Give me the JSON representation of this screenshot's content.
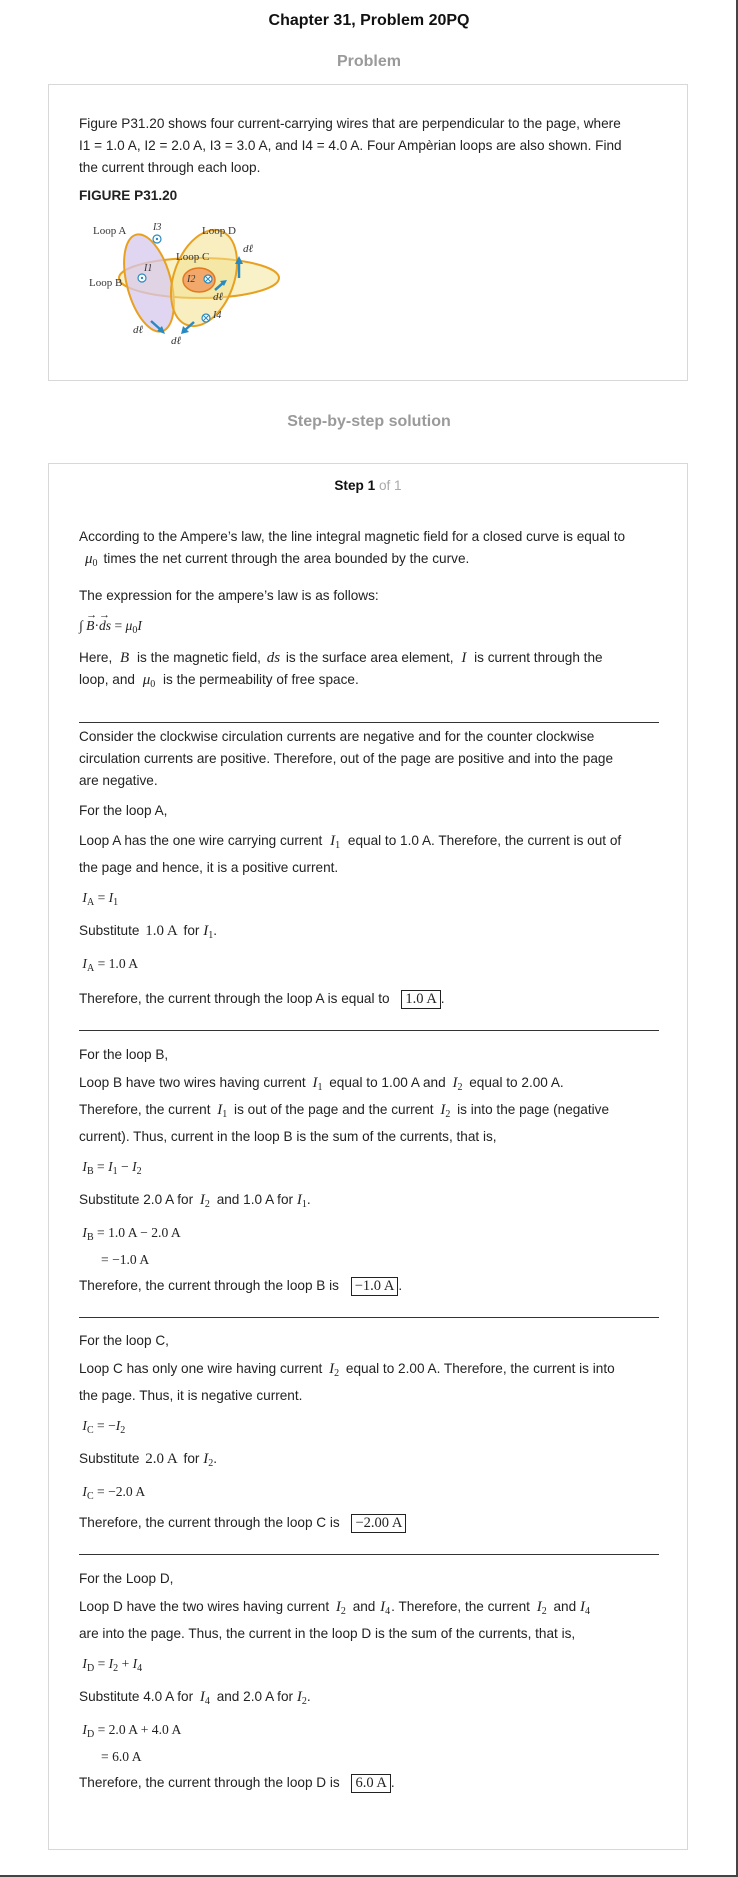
{
  "header": {
    "chapter_title": "Chapter 31, Problem 20PQ",
    "problem_label": "Problem",
    "solution_label": "Step-by-step solution"
  },
  "problem": {
    "text_line1": "Figure P31.20 shows four current-carrying wires that are perpendicular to the page, where",
    "text_line2": "I1 = 1.0 A, I2 = 2.0 A, I3 = 3.0 A, and I4 = 4.0 A. Four Ampèrian loops are also shown. Find",
    "text_line3": "the current through each loop.",
    "figure_label": "FIGURE P31.20",
    "figure": {
      "loop_a": "Loop A",
      "loop_b": "Loop B",
      "loop_c": "Loop C",
      "loop_d": "Loop D",
      "i1": "I1",
      "i2": "I2",
      "i3": "I3",
      "i4": "I4",
      "dl": "dℓ"
    }
  },
  "step": {
    "label": "Step 1",
    "of": "of 1"
  },
  "intro": {
    "p1_l1": "According to the Ampere’s law, the line integral magnetic field for a closed curve is equal to",
    "p1_l2": "times the net current through the area bounded by the curve.",
    "p2": "The expression for the ampere’s law is as follows:",
    "eq": "∫ B · ds = μ0 I",
    "p3_l1a": "Here,",
    "p3_l1b": "is the magnetic field,",
    "p3_l1c": "is the surface area element,",
    "p3_l1d": "is current through the",
    "p3_l2a": "loop, and",
    "p3_l2b": "is the permeability of free space."
  },
  "sign": {
    "l1": "Consider the clockwise circulation currents are negative and for the counter clockwise",
    "l2": "circulation currents are positive. Therefore, out of the page are positive and into the page",
    "l3": "are negative."
  },
  "loop_a": {
    "heading": "For the loop A,",
    "l1a": "Loop A has the one wire carrying current",
    "l1b": "equal to 1.0 A. Therefore, the current is out of",
    "l2": "the page and hence, it is a positive current.",
    "eq1": "IA = I1",
    "sub_a": "Substitute",
    "sub_val": "1.0 A",
    "sub_for": "for",
    "eq2": "IA = 1.0 A",
    "concl": "Therefore, the current through the loop A is equal to",
    "answer": "1.0 A"
  },
  "loop_b": {
    "heading": "For the loop B,",
    "l1a": "Loop B have two wires having current",
    "l1b": "equal to 1.00 A and",
    "l1c": "equal to 2.00 A.",
    "l2a": "Therefore, the current",
    "l2b": "is out of the page and the current",
    "l2c": "is into the page (negative",
    "l3": "current). Thus, current in the loop B is the sum of the currents, that is,",
    "eq1": "IB = I1 − I2",
    "sub_a": "Substitute 2.0 A for",
    "sub_b": "and 1.0 A for",
    "eq2": "IB = 1.0 A − 2.0 A",
    "eq3": "= −1.0 A",
    "concl": "Therefore, the current through the loop B is",
    "answer": "−1.0 A"
  },
  "loop_c": {
    "heading": "For the loop C,",
    "l1a": "Loop C has only one wire having current",
    "l1b": "equal to 2.00 A. Therefore, the current is into",
    "l2": "the page. Thus, it is negative current.",
    "eq1": "IC = −I2",
    "sub_a": "Substitute",
    "sub_val": "2.0 A",
    "sub_for": "for",
    "eq2": "IC = −2.0 A",
    "concl": "Therefore, the current through the loop C is",
    "answer": "−2.00 A"
  },
  "loop_d": {
    "heading": "For the Loop D,",
    "l1a": "Loop D have the two wires having current",
    "l1b": "and",
    "l1c": ". Therefore, the current",
    "l1d": "and",
    "l2": "are into the page. Thus, the current in the loop D is the sum of the currents, that is,",
    "eq1": "ID = I2 + I4",
    "sub_a": "Substitute 4.0 A for",
    "sub_b": "and 2.0 A for",
    "eq2": "ID = 2.0 A + 4.0 A",
    "eq3": "= 6.0 A",
    "concl": "Therefore, the current through the loop D is",
    "answer": "6.0 A"
  }
}
